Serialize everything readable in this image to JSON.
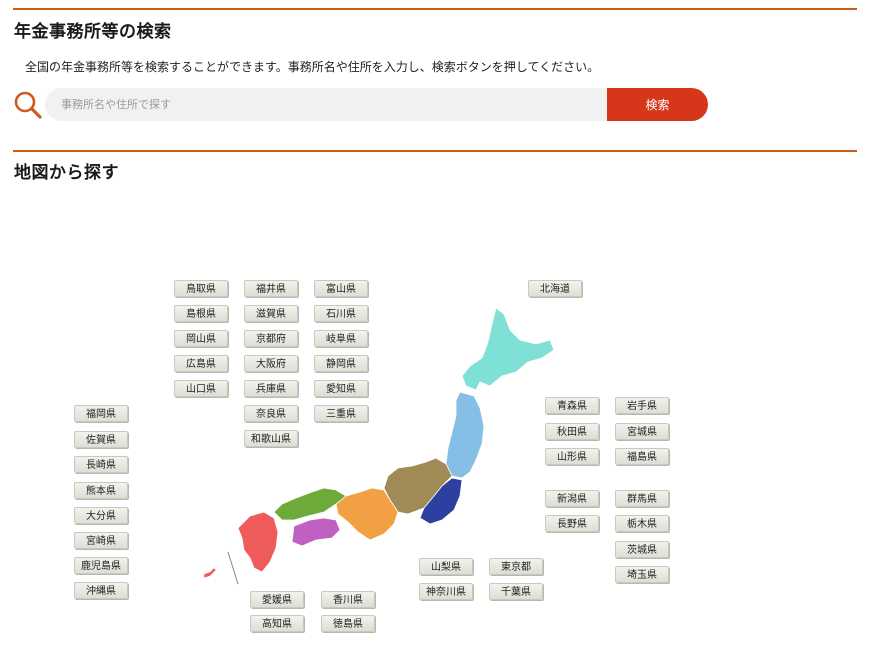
{
  "search_section": {
    "heading": "年金事務所等の検索",
    "description": "全国の年金事務所等を検索することができます。事務所名や住所を入力し、検索ボタンを押してください。",
    "placeholder": "事務所名や住所で探す",
    "button_label": "検索"
  },
  "map_section": {
    "heading": "地図から探す"
  },
  "prefectures": {
    "hokkaido": "北海道",
    "aomori": "青森県",
    "iwate": "岩手県",
    "akita": "秋田県",
    "miyagi": "宮城県",
    "yamagata": "山形県",
    "fukushima": "福島県",
    "niigata": "新潟県",
    "gunma": "群馬県",
    "nagano": "長野県",
    "tochigi": "栃木県",
    "ibaraki": "茨城県",
    "saitama": "埼玉県",
    "yamanashi": "山梨県",
    "tokyo": "東京都",
    "kanagawa": "神奈川県",
    "chiba": "千葉県",
    "tottori": "鳥取県",
    "fukui": "福井県",
    "toyama": "富山県",
    "shimane": "島根県",
    "shiga": "滋賀県",
    "ishikawa": "石川県",
    "okayama": "岡山県",
    "kyoto": "京都府",
    "gifu": "岐阜県",
    "hiroshima": "広島県",
    "osaka": "大阪府",
    "shizuoka": "静岡県",
    "yamaguchi": "山口県",
    "hyogo": "兵庫県",
    "aichi": "愛知県",
    "nara": "奈良県",
    "mie": "三重県",
    "wakayama": "和歌山県",
    "fukuoka": "福岡県",
    "saga": "佐賀県",
    "nagasaki": "長崎県",
    "kumamoto": "熊本県",
    "oita": "大分県",
    "miyazaki": "宮崎県",
    "kagoshima": "鹿児島県",
    "okinawa": "沖縄県",
    "ehime": "愛媛県",
    "kagawa": "香川県",
    "kochi": "高知県",
    "tokushima": "徳島県"
  },
  "colors": {
    "accent_rule": "#cf5a1e",
    "search_button": "#d6361a",
    "hokkaido": "#7fe0d6",
    "tohoku": "#86bfe6",
    "kanto": "#2d3fa0",
    "chubu": "#a08a56",
    "kinki": "#f2a044",
    "chugoku": "#6eaa3a",
    "shikoku": "#c060c0",
    "kyushu": "#ef5a5a"
  }
}
